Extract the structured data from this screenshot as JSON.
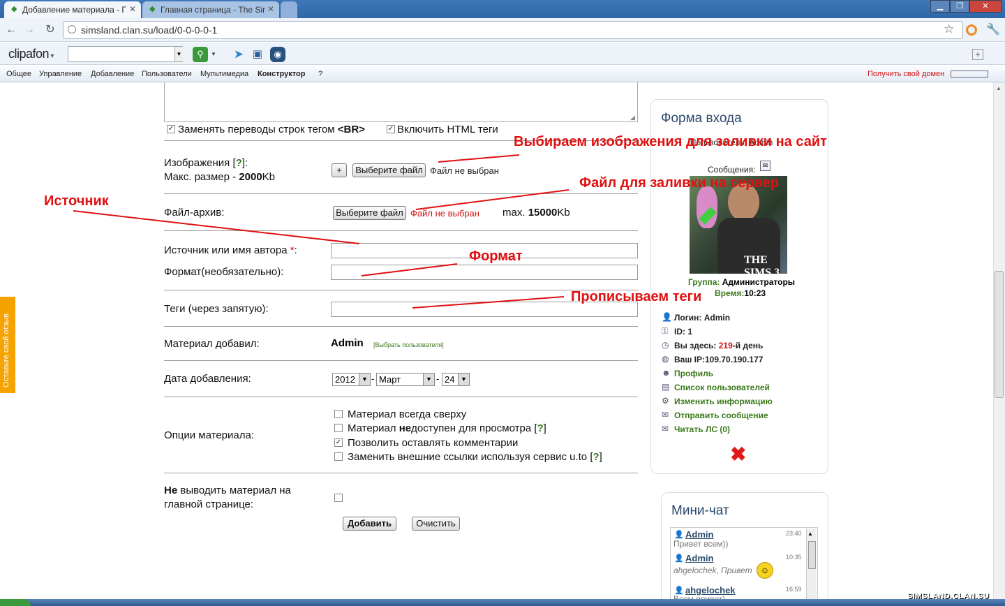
{
  "browser": {
    "tabs": [
      {
        "label": "Добавление материала - Г"
      },
      {
        "label": "Главная страница - The Sir"
      }
    ],
    "url": "simsland.clan.su/load/0-0-0-0-1",
    "clipafon_logo": "clipafon",
    "icons": {
      "back": "back-arrow-icon",
      "forward": "forward-arrow-icon",
      "reload": "reload-icon",
      "star": "star-icon"
    }
  },
  "menu": {
    "items": [
      "Общее",
      "Управление",
      "Добавление",
      "Пользователи",
      "Мультимедиа",
      "Конструктор",
      "?"
    ],
    "get_domain": "Получить свой домен"
  },
  "form": {
    "replace_br": "Заменять переводы строк тегом",
    "br_tag": "<BR>",
    "enable_html": "Включить HTML теги",
    "images_label": "Изображения [",
    "help_mark": "?",
    "images_label_end": "]:",
    "max_size_label": "Макс. размер - ",
    "max_size_value": "2000",
    "kb": "Kb",
    "plus_button": "+",
    "choose_file": "Выберите файл",
    "no_file": "Файл не выбран",
    "archive_label": "Файл-архив:",
    "archive_max_label": "max. ",
    "archive_max_value": "15000",
    "source_label": "Источник или имя автора",
    "required_mark": "*",
    "colon": ":",
    "format_label": "Формат(необязательно):",
    "tags_label": "Теги (через запятую):",
    "added_by_label": "Материал добавил:",
    "added_by_value": "Admin",
    "choose_user": "[Выбрать пользователя]",
    "date_label": "Дата добавления:",
    "date_year": "2012",
    "date_month": "Март",
    "date_day": "24",
    "dash": "-",
    "options_label": "Опции материала:",
    "options": [
      {
        "label": "Материал всегда сверху",
        "checked": false
      },
      {
        "label_a": "Материал ",
        "label_b": "не",
        "label_c": "доступен для просмотра [",
        "checked": false
      },
      {
        "label": "Позволить оставлять комментарии",
        "checked": true
      },
      {
        "label": "Заменить внешние ссылки используя сервис u.to [",
        "checked": false
      }
    ],
    "bracket_close": "]",
    "no_main_bold": "Не",
    "no_main_rest": " выводить материал на",
    "no_main_line2": "главной странице:",
    "submit": "Добавить",
    "reset": "Очистить"
  },
  "annotations": {
    "images": "Выбираем изображения для заливки на сайт",
    "file": "Файл для заливки на сервер",
    "source": "Источник",
    "format": "Формат",
    "tags": "Прописываем теги"
  },
  "login": {
    "title": "Форма входа",
    "user_row": "Пользователь: Admin",
    "messages": "Сообщения:",
    "group_label": "Группа:",
    "group_value": "Администраторы",
    "time_label": "Время:",
    "time_value": "10:23",
    "login_label": "Логин: Admin",
    "id_label": "ID: 1",
    "here_a": "Вы здесь: ",
    "here_num": "219",
    "here_b": "-й день",
    "ip": "Ваш IP:109.70.190.177",
    "links": [
      "Профиль",
      "Список пользователей",
      "Изменить информацию",
      "Отправить сообщение",
      "Читать ЛС (0)"
    ],
    "avatar_text": "THE SIMS 3"
  },
  "chat": {
    "title": "Мини-чат",
    "messages": [
      {
        "name": "Admin",
        "time": "23:40",
        "text": "Привет всем))"
      },
      {
        "name": "Admin",
        "time": "10:35",
        "text": "ahgelochek, Привет"
      },
      {
        "name": "ahgelochek",
        "time": "16:59",
        "text": "Всем привет)"
      }
    ]
  },
  "feedback": "Оставьте свой отзыв",
  "watermark": "SIMSLAND.CLAN.SU",
  "colors": {
    "annotation": "#e01010",
    "link": "#3a7a1a",
    "accent": "#2c4a6d",
    "feedback": "#f5a300"
  }
}
